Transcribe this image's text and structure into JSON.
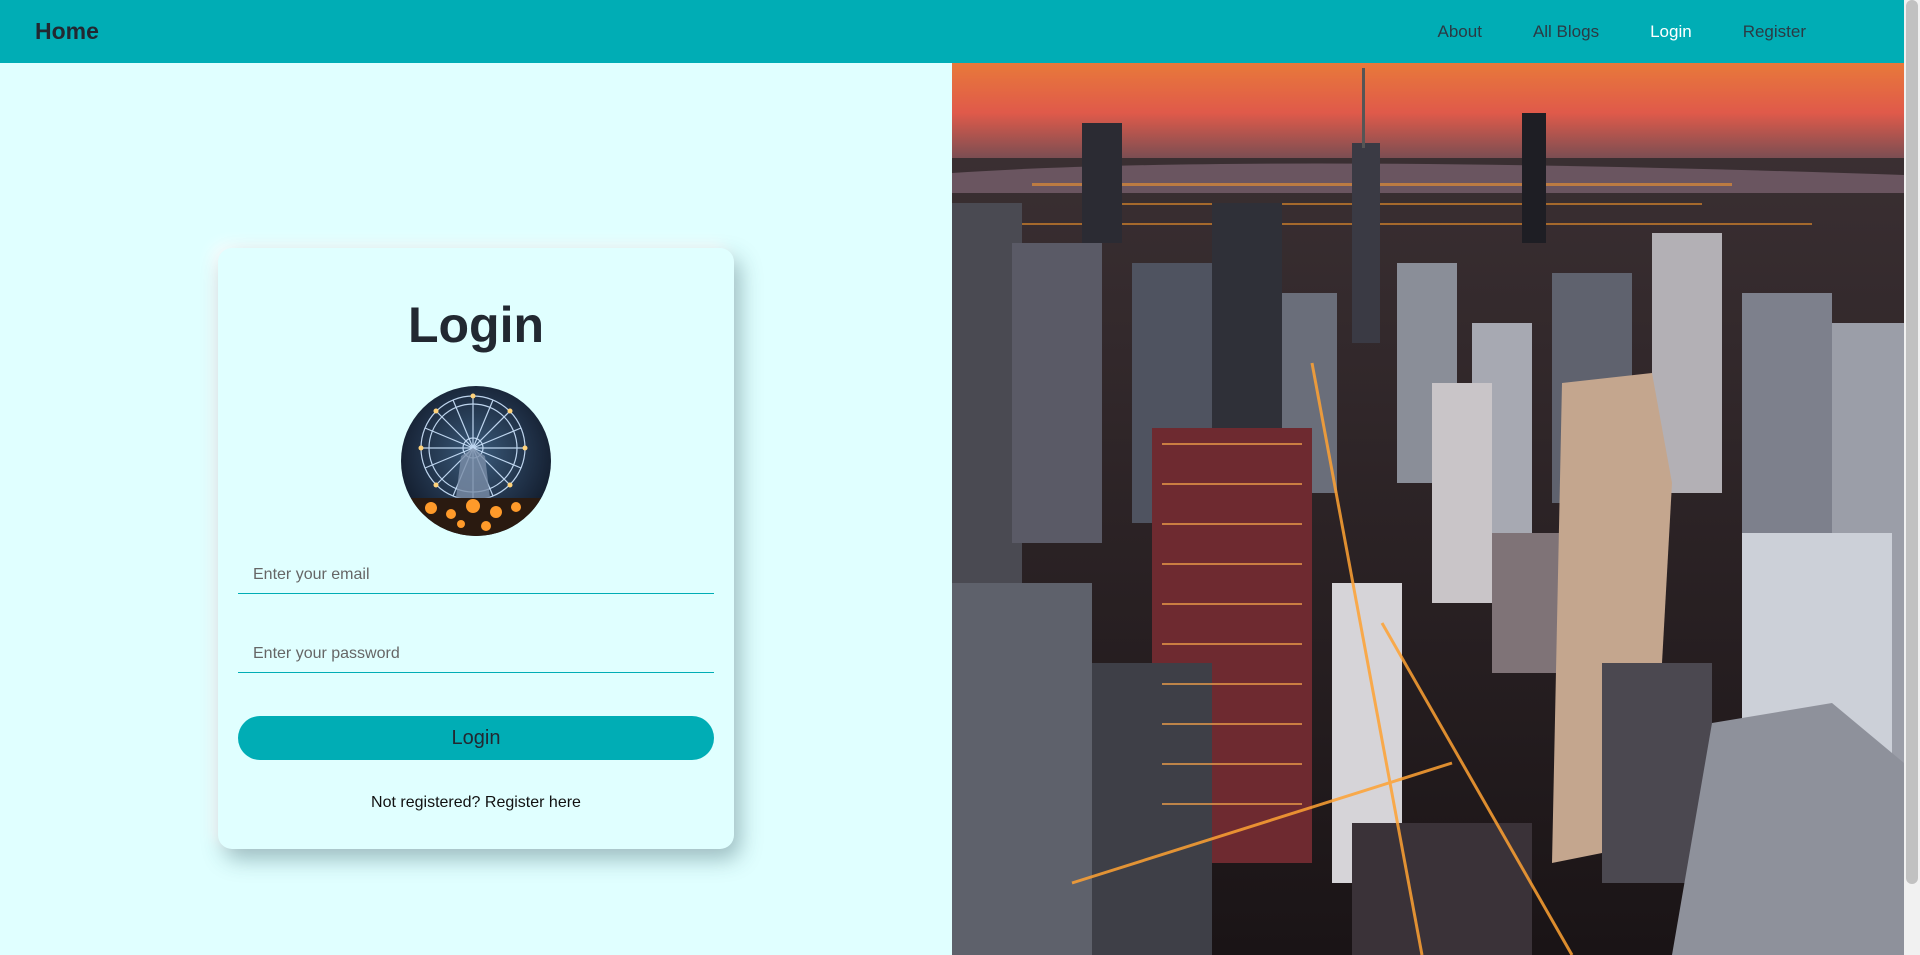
{
  "navbar": {
    "brand": "Home",
    "links": [
      {
        "label": "About",
        "active": false
      },
      {
        "label": "All Blogs",
        "active": false
      },
      {
        "label": "Login",
        "active": true
      },
      {
        "label": "Register",
        "active": false
      }
    ]
  },
  "login_card": {
    "title": "Login",
    "email_placeholder": "Enter your email",
    "password_placeholder": "Enter your password",
    "submit_label": "Login",
    "register_prompt": "Not registered?",
    "register_link": "Register here"
  },
  "colors": {
    "accent": "#00adb5",
    "background": "#e0ffff",
    "text_dark": "#222831"
  }
}
